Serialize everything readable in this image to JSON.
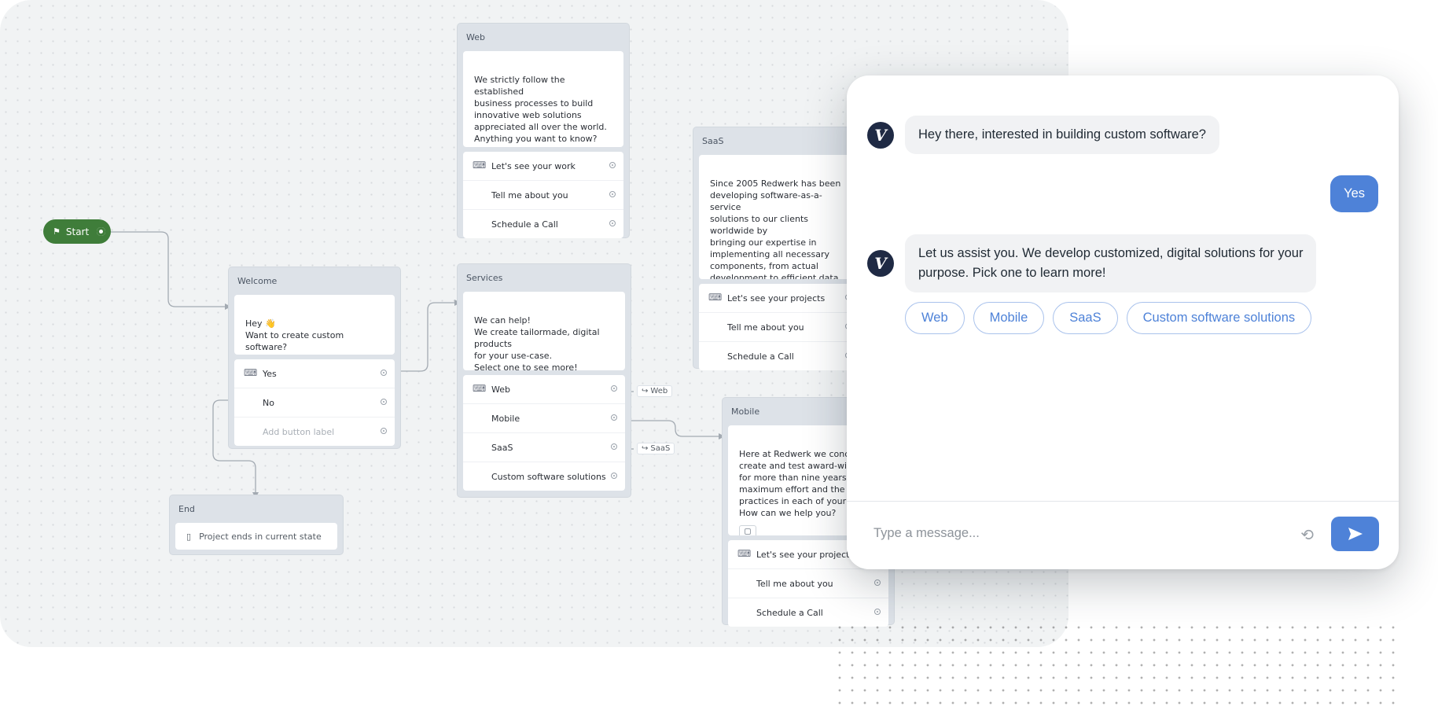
{
  "start": {
    "label": "Start"
  },
  "welcome": {
    "title": "Welcome",
    "message": "Hey 👋\nWant to create custom software?",
    "buttons": [
      "Yes",
      "No"
    ],
    "placeholder": "Add button label"
  },
  "end": {
    "title": "End",
    "text": "Project ends in current state"
  },
  "services": {
    "title": "Services",
    "message": "We can help!\nWe create tailormade, digital products\nfor your use-case.\nSelect one to see more!",
    "buttons": [
      "Web",
      "Mobile",
      "SaaS",
      "Custom software solutions"
    ],
    "tags": [
      "Web",
      "SaaS"
    ]
  },
  "web": {
    "title": "Web",
    "message": "We strictly follow the established\nbusiness processes to build\ninnovative web solutions\nappreciated all over the world.\nAnything you want to know?",
    "buttons": [
      "Let's see your work",
      "Tell me about you",
      "Schedule a Call"
    ]
  },
  "saas": {
    "title": "SaaS",
    "message": "Since 2005 Redwerk has been\ndeveloping software-as-a-service\nsolutions to our clients worldwide by\nbringing our expertise in\nimplementing all necessary\ncomponents, from actual\ndevelopment to efficient data storage\nand cloud hosting. How can we help\nyou?",
    "buttons": [
      "Let's see your projects",
      "Tell me about you",
      "Schedule a Call"
    ]
  },
  "mobile": {
    "title": "Mobile",
    "message": "Here at Redwerk we conceptu\ncreate and test award-winnin\nfor more than nine years putt\nmaximum effort and the lates\npractices in each of your proje\nHow can we help you?",
    "buttons": [
      "Let's see your projects",
      "Tell me about you",
      "Schedule a Call"
    ]
  },
  "chat": {
    "avatar_letter": "V",
    "bot_message_1": "Hey there, interested in building custom software?",
    "user_message": "Yes",
    "bot_message_2_line1": "Let us assist you. We develop customized, digital solutions for your",
    "bot_message_2_line2": "purpose. Pick one to learn more!",
    "quick_replies": [
      "Web",
      "Mobile",
      "SaaS",
      "Custom software solutions"
    ],
    "input_placeholder": "Type a message...",
    "accent_color": "#4e82d8"
  }
}
